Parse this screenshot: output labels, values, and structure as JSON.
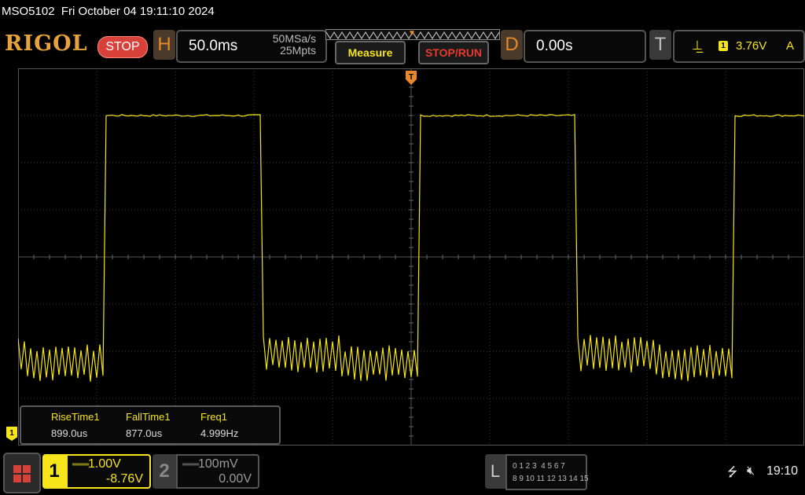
{
  "status": {
    "model": "MSO5102",
    "datetime": "Fri October 04 19:11:10 2024"
  },
  "brand": {
    "logo": "RIGOL",
    "run_state": "STOP"
  },
  "horizontal": {
    "label": "H",
    "timebase": "50.0ms",
    "sample_rate": "50MSa/s",
    "memory_depth": "25Mpts"
  },
  "buttons": {
    "measure": "Measure",
    "stop_run": "STOP/RUN"
  },
  "delay": {
    "label": "D",
    "value": "0.00s"
  },
  "trigger": {
    "label": "T",
    "source": "1",
    "level": "3.76V",
    "mode": "A",
    "slope_icon": "rising-edge-icon"
  },
  "measurements": [
    {
      "name": "RiseTime1",
      "value": "899.0us"
    },
    {
      "name": "FallTime1",
      "value": "877.0us"
    },
    {
      "name": "Freq1",
      "value": "4.999Hz"
    }
  ],
  "channels": [
    {
      "number": "1",
      "scale": "1.00V",
      "offset": "-8.76V",
      "active": true,
      "color": "#f5e51a"
    },
    {
      "number": "2",
      "scale": "100mV",
      "offset": "0.00V",
      "active": false,
      "color": "#9a9a9a"
    }
  ],
  "ch1_marker": "1",
  "logic": {
    "label": "L",
    "row1": "0 1 2 3  4 5 6 7",
    "row2": "8 9 10 11 12 13 14 15"
  },
  "system": {
    "time": "19:10"
  },
  "colors": {
    "trace": "#f5e51a",
    "accent": "#e8882c",
    "stop": "#d8403a"
  },
  "waveform": {
    "period_divs": 4.0,
    "duty": 0.5,
    "first_rise_div": 1.1,
    "high_level_divs": 3.0,
    "low_level_divs": -2.15,
    "noise_pp_divs": 0.8
  }
}
